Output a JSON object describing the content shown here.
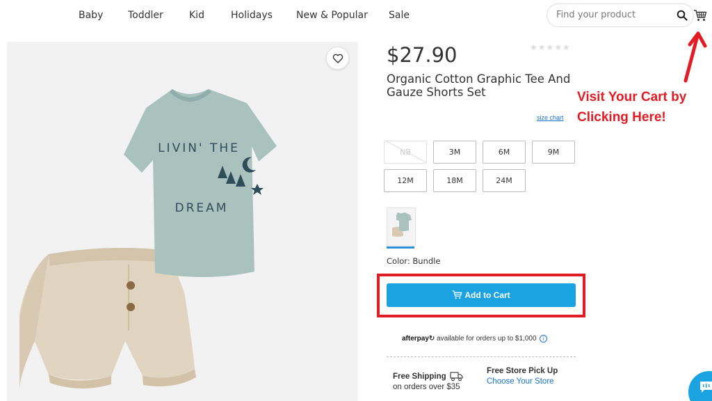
{
  "nav": {
    "items": [
      "Baby",
      "Toddler",
      "Kid",
      "Holidays",
      "New & Popular",
      "Sale"
    ]
  },
  "search": {
    "placeholder": "Find your product"
  },
  "product": {
    "price": "$27.90",
    "rating_stars": "★★★★★",
    "rating_value": 0,
    "title": "Organic Cotton Graphic Tee And Gauze Shorts Set",
    "size_chart_label": "size chart",
    "sizes": [
      {
        "label": "NB",
        "available": false
      },
      {
        "label": "3M",
        "available": true
      },
      {
        "label": "6M",
        "available": true
      },
      {
        "label": "9M",
        "available": true
      },
      {
        "label": "12M",
        "available": true
      },
      {
        "label": "18M",
        "available": true
      },
      {
        "label": "24M",
        "available": true
      }
    ],
    "color_label": "Color: Bundle",
    "add_to_cart_label": "Add to Cart",
    "tee_graphic": {
      "line1": "LIVIN' THE",
      "line2": "DREAM"
    }
  },
  "afterpay": {
    "logo": "afterpay",
    "text": "available for orders up to $1,000"
  },
  "shipping": {
    "title": "Free Shipping",
    "subtitle": "on orders over $35"
  },
  "pickup": {
    "title": "Free Store Pick Up",
    "link": "Choose Your Store"
  },
  "annotation": {
    "line1": "Visit Your Cart by",
    "line2": "Clicking Here!"
  },
  "colors": {
    "accent_blue": "#1aa3e0",
    "link_blue": "#1a73c8",
    "annotation_red": "#e01c24"
  }
}
